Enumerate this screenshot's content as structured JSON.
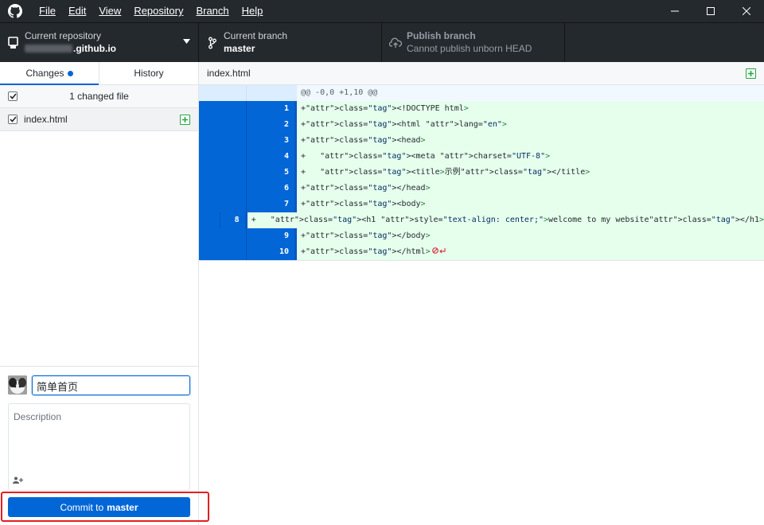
{
  "menu": {
    "items": [
      "File",
      "Edit",
      "View",
      "Repository",
      "Branch",
      "Help"
    ]
  },
  "toolbar": {
    "repo_label": "Current repository",
    "repo_value": ".github.io",
    "branch_label": "Current branch",
    "branch_value": "master",
    "publish_label": "Publish branch",
    "publish_value": "Cannot publish unborn HEAD"
  },
  "sidebar": {
    "tab_changes": "Changes",
    "tab_history": "History",
    "changed_count": "1 changed file",
    "files": [
      {
        "name": "index.html",
        "status": "added"
      }
    ]
  },
  "commit": {
    "summary_value": "简单首页",
    "description_placeholder": "Description",
    "button_prefix": "Commit to",
    "button_branch": "master"
  },
  "diff": {
    "filename": "index.html",
    "hunk_header": "@@ -0,0 +1,10 @@",
    "lines": [
      {
        "num": "1",
        "text": "+<!DOCTYPE html>"
      },
      {
        "num": "2",
        "text": "+<html lang=\"en\">"
      },
      {
        "num": "3",
        "text": "+<head>"
      },
      {
        "num": "4",
        "text": "+   <meta charset=\"UTF-8\">"
      },
      {
        "num": "5",
        "text": "+   <title>示例</title>"
      },
      {
        "num": "6",
        "text": "+</head>"
      },
      {
        "num": "7",
        "text": "+<body>"
      },
      {
        "num": "8",
        "text": "+   <h1 style=\"text-align: center;\">welcome to my website</h1>"
      },
      {
        "num": "9",
        "text": "+</body>"
      },
      {
        "num": "10",
        "text": "+</html>"
      }
    ]
  },
  "colors": {
    "accent": "#0366d6",
    "titlebar": "#24292e",
    "added_bg": "#e6ffed",
    "highlight": "#e41e1e"
  }
}
